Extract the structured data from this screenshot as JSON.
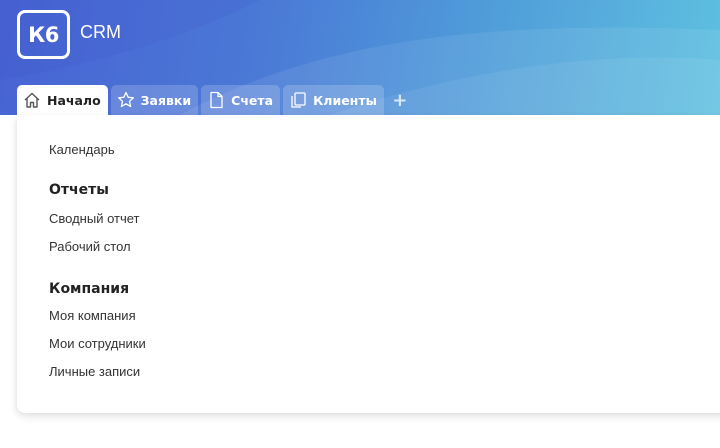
{
  "header": {
    "logo_text": "К6",
    "app_title": "CRM"
  },
  "tabs": [
    {
      "label": "Начало",
      "icon": "home-icon",
      "active": true
    },
    {
      "label": "Заявки",
      "icon": "star-icon",
      "active": false
    },
    {
      "label": "Счета",
      "icon": "document-icon",
      "active": false
    },
    {
      "label": "Клиенты",
      "icon": "copy-icon",
      "active": false
    }
  ],
  "add_tab_label": "+",
  "menu": {
    "calendar": "Календарь",
    "reports_heading": "Отчеты",
    "summary_report": "Сводный отчет",
    "desktop": "Рабочий стол",
    "company_heading": "Компания",
    "my_company": "Моя компания",
    "my_employees": "Мои сотрудники",
    "personal_notes": "Личные записи"
  },
  "colors": {
    "header_start": "#4863d3",
    "header_end": "#5ec0e0",
    "text": "#333333"
  }
}
